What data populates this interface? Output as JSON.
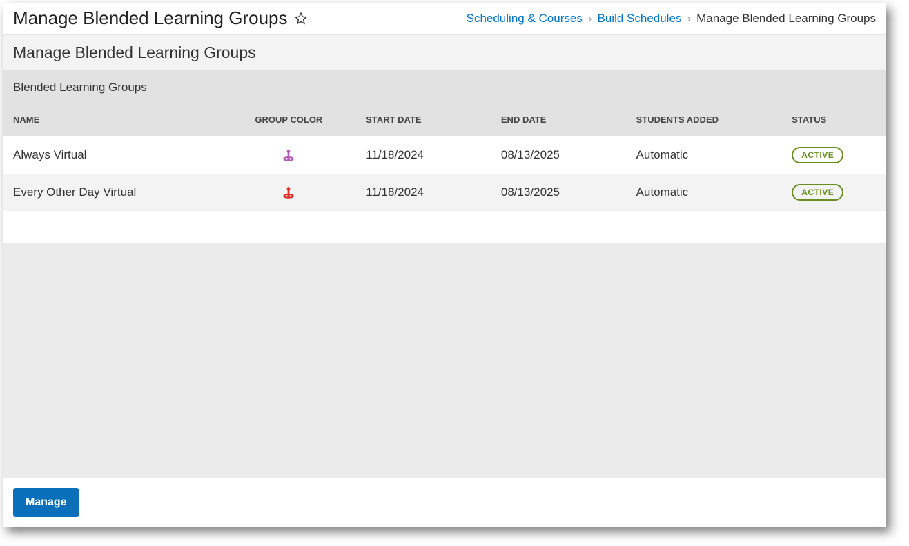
{
  "header": {
    "title": "Manage Blended Learning Groups",
    "breadcrumbs": [
      {
        "label": "Scheduling & Courses",
        "link": true
      },
      {
        "label": "Build Schedules",
        "link": true
      },
      {
        "label": "Manage Blended Learning Groups",
        "link": false
      }
    ]
  },
  "section_title": "Manage Blended Learning Groups",
  "panel_title": "Blended Learning Groups",
  "columns": {
    "name": "NAME",
    "group_color": "GROUP COLOR",
    "start_date": "START DATE",
    "end_date": "END DATE",
    "students_added": "STUDENTS ADDED",
    "status": "STATUS"
  },
  "rows": [
    {
      "name": "Always Virtual",
      "color": "#b15fb3",
      "start": "11/18/2024",
      "end": "08/13/2025",
      "added": "Automatic",
      "status": "ACTIVE"
    },
    {
      "name": "Every Other Day Virtual",
      "color": "#e12a2a",
      "start": "11/18/2024",
      "end": "08/13/2025",
      "added": "Automatic",
      "status": "ACTIVE"
    }
  ],
  "footer": {
    "manage_label": "Manage"
  }
}
